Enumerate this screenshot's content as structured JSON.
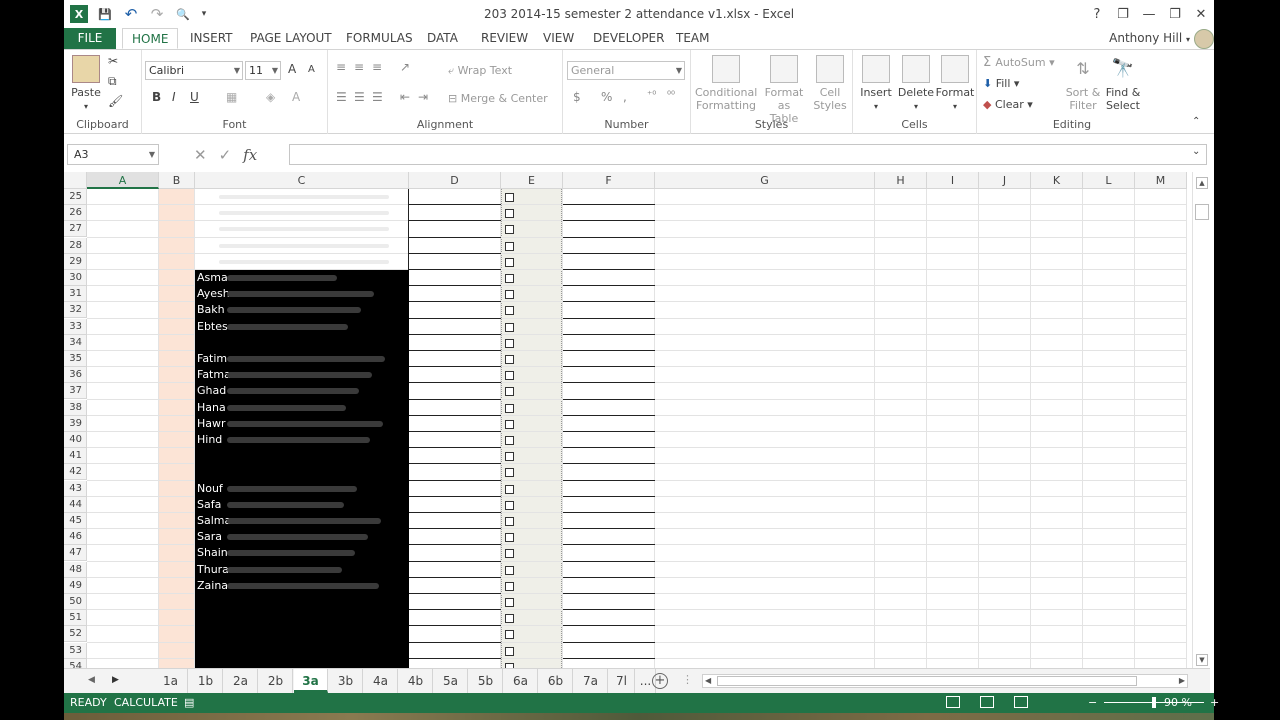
{
  "window": {
    "title": "203 2014-15  semester 2 attendance v1.xlsx - Excel",
    "help": "?",
    "minimize": "—",
    "restore": "❐",
    "close": "✕"
  },
  "qat": {
    "excel_logo": "X",
    "save": "💾",
    "undo": "↶",
    "redo": "↷",
    "print_preview": "🔍",
    "customize": "▾"
  },
  "tabs": [
    "FILE",
    "HOME",
    "INSERT",
    "PAGE LAYOUT",
    "FORMULAS",
    "DATA",
    "REVIEW",
    "VIEW",
    "DEVELOPER",
    "TEAM"
  ],
  "user": {
    "name": "Anthony Hill",
    "caret": "▾"
  },
  "ribbon": {
    "clipboard": {
      "label": "Clipboard",
      "paste": "Paste"
    },
    "font": {
      "label": "Font",
      "family": "Calibri",
      "size": "11",
      "grow": "A",
      "shrink": "A",
      "bold": "B",
      "italic": "I",
      "underline": "U"
    },
    "alignment": {
      "label": "Alignment",
      "wrap": "Wrap Text",
      "merge": "Merge & Center"
    },
    "number": {
      "label": "Number",
      "format": "General",
      "currency": "$",
      "percent": "%",
      "comma": ","
    },
    "styles": {
      "label": "Styles",
      "conditional": [
        "Conditional",
        "Formatting"
      ],
      "format_table": [
        "Format as",
        "Table"
      ],
      "cell_styles": [
        "Cell",
        "Styles"
      ]
    },
    "cells": {
      "label": "Cells",
      "insert": "Insert",
      "delete": "Delete",
      "format": "Format"
    },
    "editing": {
      "label": "Editing",
      "autosum": "AutoSum",
      "fill": "Fill",
      "clear": "Clear",
      "sort": [
        "Sort &",
        "Filter"
      ],
      "find": [
        "Find &",
        "Select"
      ]
    }
  },
  "formula_bar": {
    "name_box": "A3",
    "cancel": "✕",
    "enter": "✓",
    "fx": "fx",
    "value": ""
  },
  "columns": [
    "A",
    "B",
    "C",
    "D",
    "E",
    "F",
    "G",
    "H",
    "I",
    "J",
    "K",
    "L",
    "M"
  ],
  "rows": [
    "25",
    "26",
    "27",
    "28",
    "29",
    "30",
    "31",
    "32",
    "33",
    "34",
    "35",
    "36",
    "37",
    "38",
    "39",
    "40",
    "41",
    "42",
    "43",
    "44",
    "45",
    "46",
    "47",
    "48",
    "49",
    "50",
    "51",
    "52",
    "53",
    "54"
  ],
  "names": [
    {
      "row": 30,
      "text": "Asma"
    },
    {
      "row": 31,
      "text": "Ayesh"
    },
    {
      "row": 32,
      "text": "Bakh"
    },
    {
      "row": 33,
      "text": "Ebtes"
    },
    {
      "row": 35,
      "text": "Fatim"
    },
    {
      "row": 36,
      "text": "Fatma"
    },
    {
      "row": 37,
      "text": "Ghad"
    },
    {
      "row": 38,
      "text": "Hana"
    },
    {
      "row": 39,
      "text": "Hawr"
    },
    {
      "row": 40,
      "text": "Hind"
    },
    {
      "row": 43,
      "text": "Nouf"
    },
    {
      "row": 44,
      "text": "Safa"
    },
    {
      "row": 45,
      "text": "Salma"
    },
    {
      "row": 46,
      "text": "Sara"
    },
    {
      "row": 47,
      "text": "Shain"
    },
    {
      "row": 48,
      "text": "Thura"
    },
    {
      "row": 49,
      "text": "Zaina"
    }
  ],
  "sheets": [
    "1a",
    "1b",
    "2a",
    "2b",
    "3a",
    "3b",
    "4a",
    "4b",
    "5a",
    "5b",
    "6a",
    "6b",
    "7a",
    "7l",
    "..."
  ],
  "active_sheet": "3a",
  "status": {
    "mode": "READY",
    "calc": "CALCULATE",
    "zoom": "90 %",
    "minus": "−",
    "plus": "+"
  },
  "colors": {
    "excel_green": "#217346",
    "col_b_fill": "#fce4d6"
  }
}
